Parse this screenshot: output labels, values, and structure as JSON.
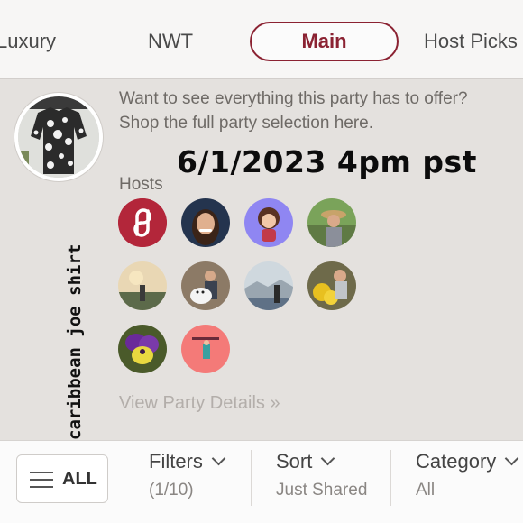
{
  "tabs": [
    {
      "label": "Luxury"
    },
    {
      "label": "NWT"
    },
    {
      "label": "Main",
      "active": true
    },
    {
      "label": "Host Picks"
    }
  ],
  "party": {
    "intro_text": "Want to see everything this party has to offer? Shop the full party selection here.",
    "overlay_date": "6/1/2023 4pm pst",
    "vertical_caption": "caribbean joe shirt",
    "hosts_label": "Hosts",
    "view_details_label": "View Party Details »",
    "hosts": [
      {
        "name": "host-poshmark-logo"
      },
      {
        "name": "host-avatar-2"
      },
      {
        "name": "host-avatar-3"
      },
      {
        "name": "host-avatar-4"
      },
      {
        "name": "host-avatar-5"
      },
      {
        "name": "host-avatar-6"
      },
      {
        "name": "host-avatar-7"
      },
      {
        "name": "host-avatar-8"
      },
      {
        "name": "host-avatar-9"
      },
      {
        "name": "host-avatar-10"
      }
    ]
  },
  "filter_bar": {
    "all_label": "ALL",
    "filters": {
      "title": "Filters",
      "value": "(1/10)"
    },
    "sort": {
      "title": "Sort",
      "value": "Just Shared"
    },
    "category": {
      "title": "Category",
      "value": "All"
    }
  },
  "colors": {
    "accent": "#8b2232",
    "background": "#e4e1de",
    "muted_text": "#6e6a66"
  }
}
